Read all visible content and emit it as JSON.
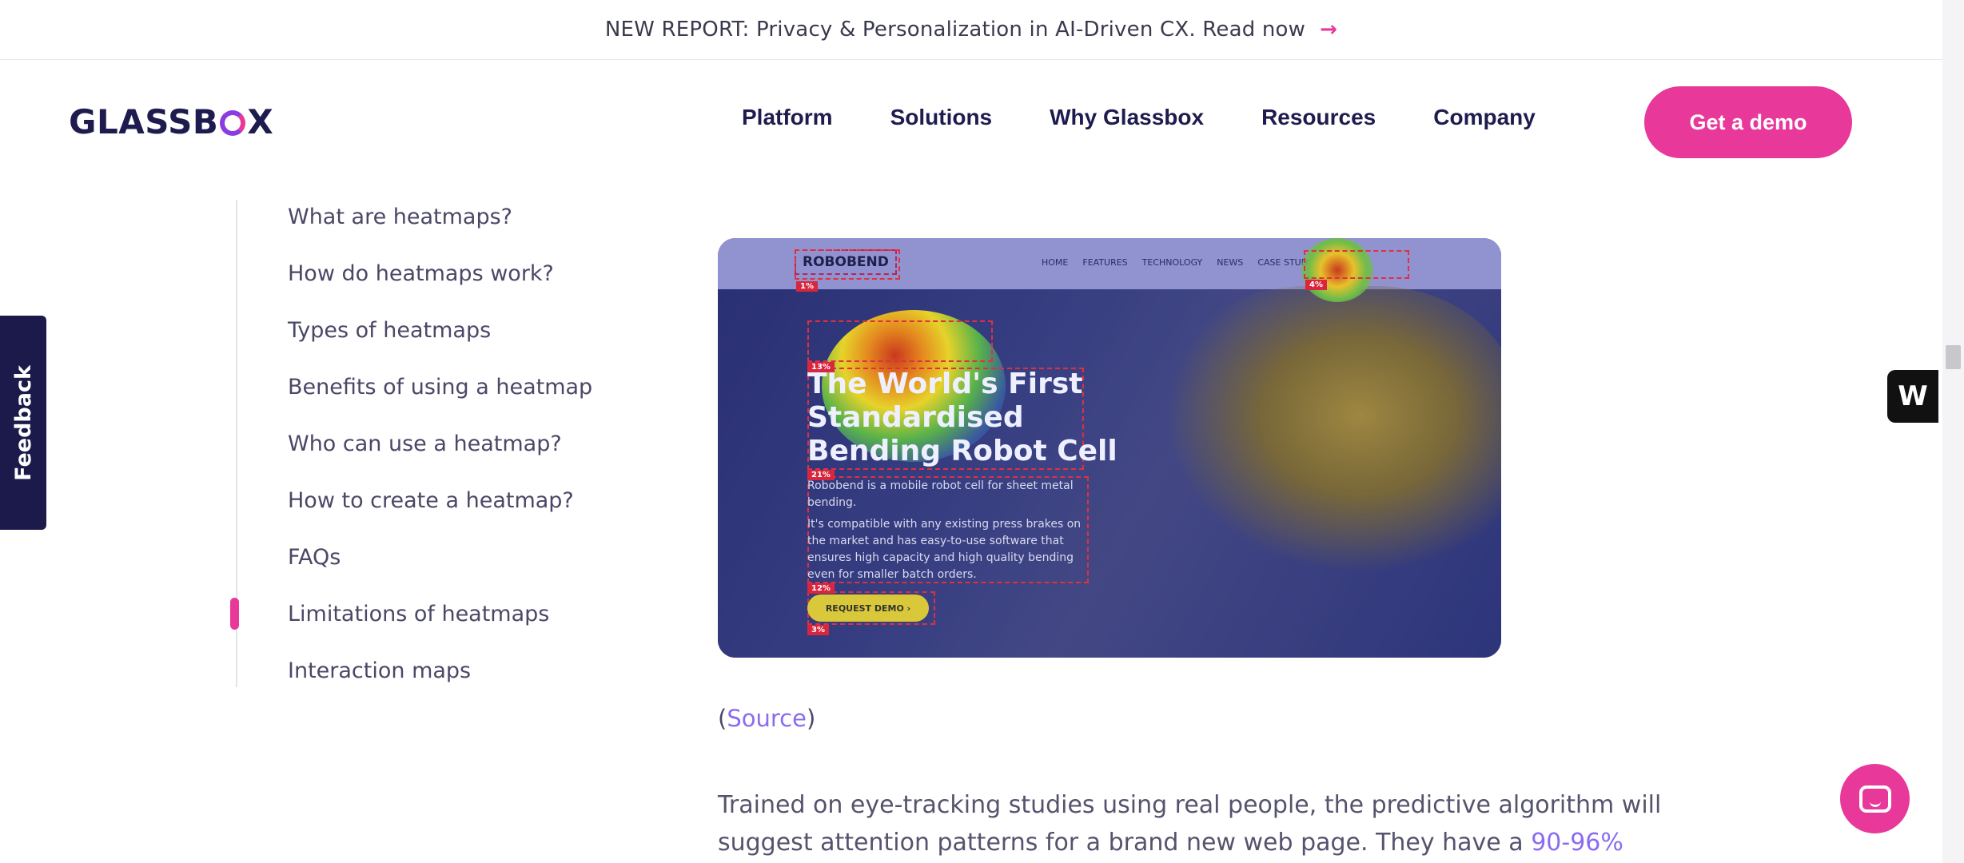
{
  "announcement": {
    "text": "NEW REPORT: Privacy & Personalization in AI-Driven CX. Read now",
    "arrow": "→"
  },
  "logo": {
    "text_before": "GLASSB",
    "text_after": "X"
  },
  "nav": [
    "Platform",
    "Solutions",
    "Why Glassbox",
    "Resources",
    "Company"
  ],
  "cta": "Get a demo",
  "feedback": "Feedback",
  "toc": {
    "items": [
      "What are heatmaps?",
      "How do heatmaps work?",
      "Types of heatmaps",
      "Benefits of using a heatmap",
      "Who can use a heatmap?",
      "How to create a heatmap?",
      "FAQs",
      "Limitations of heatmaps",
      "Interaction maps"
    ],
    "active_index": 7
  },
  "hero_image": {
    "brand": "ROBOBEND",
    "nav": [
      "HOME",
      "FEATURES",
      "TECHNOLOGY",
      "NEWS",
      "CASE STUDY"
    ],
    "headline": [
      "The World's First",
      "Standardised",
      "Bending Robot Cell"
    ],
    "paragraph1": "Robobend is a mobile robot cell for sheet metal bending.",
    "paragraph2": "It's compatible with any existing press brakes on the market and has easy-to-use software that ensures high capacity and high quality bending even for smaller batch orders.",
    "demo_button": "REQUEST DEMO ›",
    "badges": [
      "1%",
      "4%",
      "13%",
      "21%",
      "12%",
      "3%"
    ]
  },
  "source": {
    "open": "(",
    "link": "Source",
    "close": ")"
  },
  "body": {
    "text": "Trained on eye-tracking studies using real people, the predictive algorithm will suggest attention patterns for a brand new web page. They have a ",
    "link": "90-96%"
  },
  "side_widget": "W",
  "colors": {
    "accent": "#e8389a",
    "brand_dark": "#1e1c4f",
    "link": "#8a6cf0"
  }
}
